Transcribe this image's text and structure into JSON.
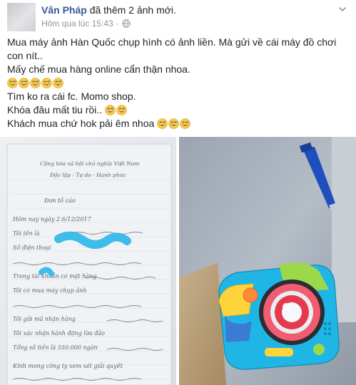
{
  "post": {
    "author": "Vân Pháp",
    "action": "đã thêm 2 ảnh mới.",
    "time": "Hôm qua lúc 15:43",
    "privacy_icon": "globe-icon",
    "menu_icon": "chevron-down-icon",
    "lines": [
      "Mua máy ảnh Hàn Quốc chụp hình có ảnh liền. Mà gửi về cái máy đồ chơi",
      "con nít..",
      "Mấy chế mua hàng online cẩn thận nhoa.",
      "",
      "Tìm ko ra cái fc. Momo shop.",
      "Khóa đâu mất tiu rồi..",
      "Khách mua chứ hok pải êm nhoa"
    ],
    "emoji": "grinning-sweat-emoji"
  },
  "photos": {
    "left": {
      "description_icon": "handwritten-letter-photo",
      "handwriting": [
        "Cộng hòa xã hội chủ nghĩa Việt Nam",
        "Độc lập - Tự do - Hạnh phúc",
        "Đơn tố cáo",
        "Hôm nay ngày 2.6/12/2017",
        "Tôi tên là",
        "Số điện thoại",
        "Trong tài khoản có mặt hàng",
        "Tôi có mua máy chụp ảnh",
        "Tôi gửi mã nhận hàng",
        "Tôi xác nhận hành động lừa đảo",
        "Tổng số tiền là 550.000 ngàn",
        "Kính mong công ty xem xét giải quyết"
      ]
    },
    "right": {
      "description_icon": "toy-camera-photo"
    }
  },
  "colors": {
    "link": "#365899",
    "meta": "#90949c",
    "text": "#1d2129",
    "emoji": "#f7c948"
  }
}
